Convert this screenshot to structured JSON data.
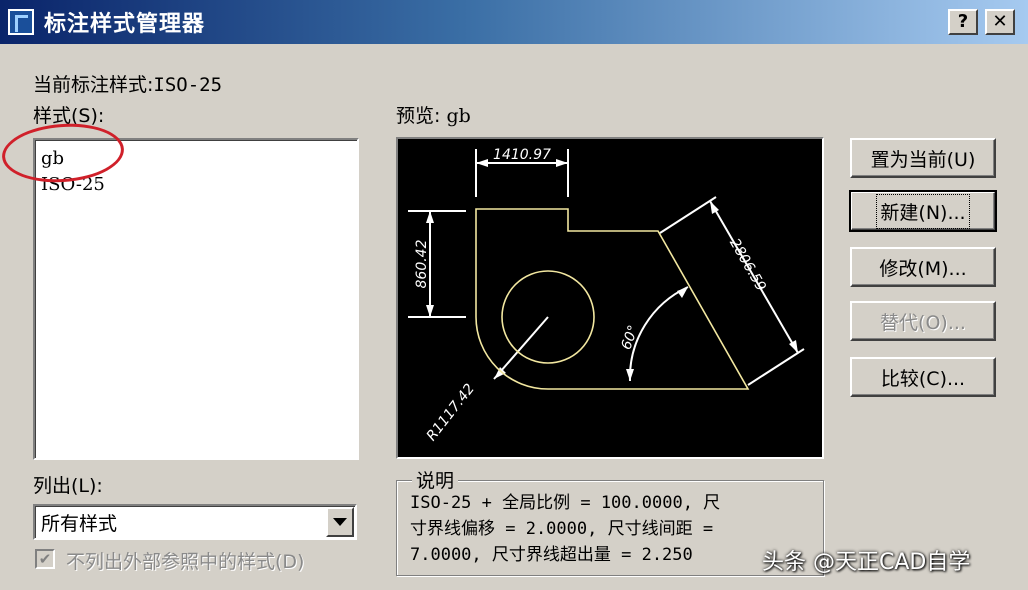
{
  "window": {
    "title": "标注样式管理器",
    "help_button": "?",
    "close_button": "✕"
  },
  "current_style": {
    "label": "当前标注样式:",
    "value": "ISO-25"
  },
  "styles_list": {
    "label": "样式(S):",
    "items": [
      "gb",
      "ISO-25"
    ]
  },
  "preview": {
    "label": "预览:",
    "style_name": "gb",
    "dim_top": "1410.97",
    "dim_left": "860.42",
    "dim_right": "2806.59",
    "dim_angle": "60°",
    "dim_radius": "R1117.42"
  },
  "buttons": {
    "set_current": "置为当前(U)",
    "new": "新建(N)...",
    "modify": "修改(M)...",
    "override": "替代(O)...",
    "compare": "比较(C)..."
  },
  "list_filter": {
    "label": "列出(L):",
    "selected": "所有样式"
  },
  "checkbox": {
    "label": "不列出外部参照中的样式(D)",
    "checked": true
  },
  "description": {
    "title": "说明",
    "line1": "ISO-25 + 全局比例 = 100.0000, 尺",
    "line2": "寸界线偏移 = 2.0000, 尺寸线间距 =",
    "line3": "7.0000, 尺寸界线超出量 = 2.250"
  },
  "watermark": "头条 @天正CAD自学"
}
